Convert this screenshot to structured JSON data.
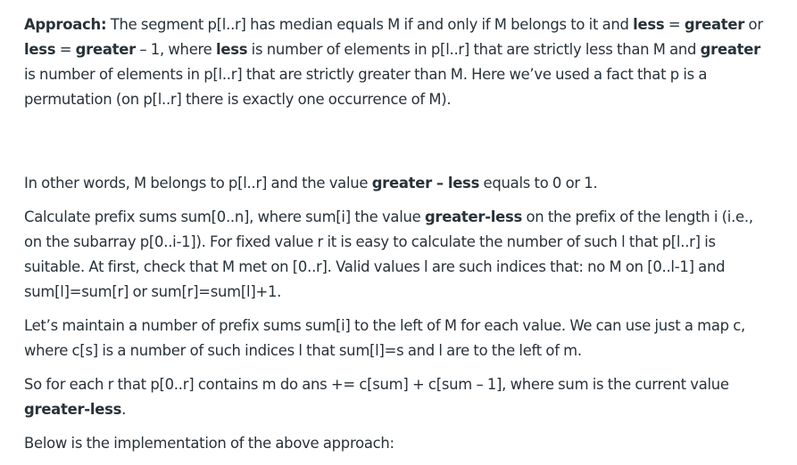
{
  "p1": {
    "s1_label": "Approach:",
    "s1_a": " The segment p[l..r] has median equals M if and only if M belongs to it and ",
    "s1_b1": "less",
    "s1_c": " = ",
    "s1_b2": "greater",
    "s1_d": " or ",
    "s1_b3": "less",
    "s1_e": " = ",
    "s1_b4": "greater",
    "s1_f": " – 1, where ",
    "s1_b5": "less",
    "s1_g": " is number of elements in p[l..r] that are strictly less than M and ",
    "s1_b6": "greater",
    "s1_h": " is number of elements in p[l..r] that are strictly greater than M. Here we’ve used a fact that p is a permutation (on p[l..r] there is exactly one occurrence of M)."
  },
  "p2": {
    "a": "In other words, M belongs to p[l..r] and the value ",
    "b": "greater – less",
    "c": " equals to 0 or 1."
  },
  "p3": {
    "a": "Calculate prefix sums sum[0..n], where sum[i] the value ",
    "b": "greater-less",
    "c": " on the prefix of the length i (i.e., on the subarray p[0..i-1]). For fixed value r it is easy to calculate the number of such l that p[l..r] is suitable. At first, check that M met on [0..r]. Valid values l are such indices that: no M on [0..l-1] and sum[l]=sum[r] or sum[r]=sum[l]+1."
  },
  "p4": {
    "a": "Let’s maintain a number of prefix sums sum[i] to the left of M for each value. We can use just a map c, where c[s] is a number of such indices l that sum[l]=s and l are to the left of m."
  },
  "p5": {
    "a": "So for each r that p[0..r] contains m do ans += c[sum] + c[sum – 1], where sum is the current value ",
    "b": "greater-less",
    "c": "."
  },
  "p6": {
    "a": "Below is the implementation of the above approach:"
  }
}
